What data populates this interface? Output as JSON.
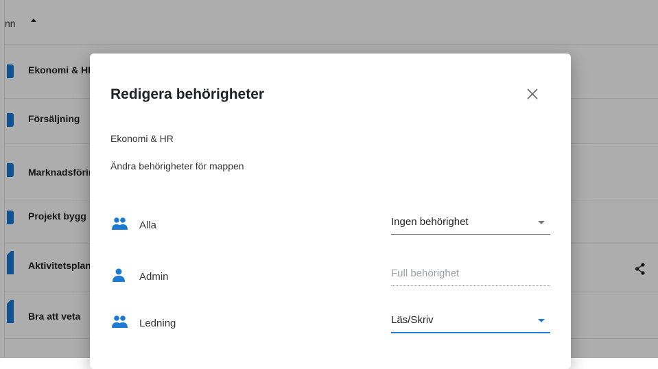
{
  "background": {
    "column_header": "nn",
    "rows": [
      {
        "label": "Ekonomi & HR"
      },
      {
        "label": "Försäljning"
      },
      {
        "label": "Marknadsföring"
      },
      {
        "label": "Projekt bygg"
      },
      {
        "label": "Aktivitetsplan"
      },
      {
        "label": "Bra att veta"
      }
    ]
  },
  "dialog": {
    "title": "Redigera behörigheter",
    "folder_name": "Ekonomi & HR",
    "description": "Ändra behörigheter för mappen",
    "permissions": [
      {
        "group": "Alla",
        "icon": "group-icon",
        "value": "Ingen behörighet",
        "state": "default"
      },
      {
        "group": "Admin",
        "icon": "person-icon",
        "value": "Full behörighet",
        "state": "disabled"
      },
      {
        "group": "Ledning",
        "icon": "group-icon",
        "value": "Läs/Skriv",
        "state": "focused"
      }
    ]
  },
  "colors": {
    "accent": "#1a7ad4",
    "overlay": "rgba(0,0,0,0.32)"
  }
}
